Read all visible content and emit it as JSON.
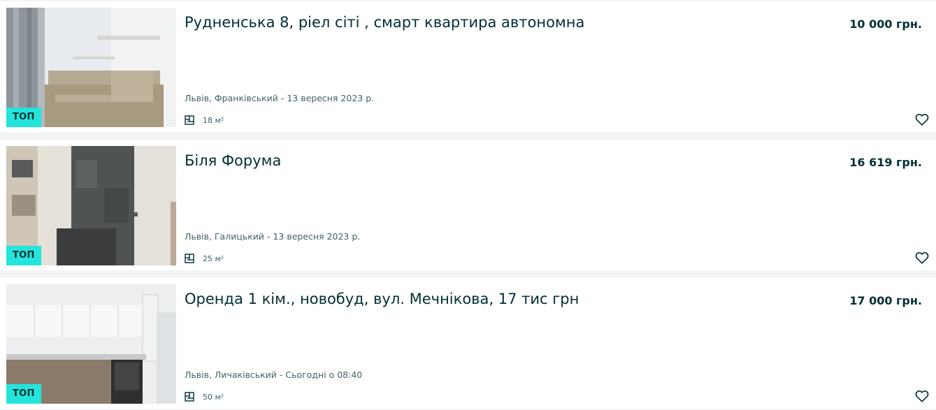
{
  "listings": [
    {
      "title": "Рудненська 8, ріел сіті , смарт квартира автономна",
      "price": "10 000 грн.",
      "location_date": "Львів, Франківський - 13 вересня 2023 р.",
      "area": "18 м²",
      "badge": "ТОП"
    },
    {
      "title": "Біля Форума",
      "price": "16 619 грн.",
      "location_date": "Львів, Галицький - 13 вересня 2023 р.",
      "area": "25 м²",
      "badge": "ТОП"
    },
    {
      "title": "Оренда 1 кім., новобуд, вул. Мечнікова, 17 тис грн",
      "price": "17 000 грн.",
      "location_date": "Львів, Личаківський - Сьогодні о 08:40",
      "area": "50 м²",
      "badge": "ТОП"
    }
  ],
  "icons": {
    "area": "floor-plan-icon",
    "favorite": "heart-outline-icon"
  },
  "colors": {
    "badge": "#23e5db",
    "text": "#002f34",
    "muted": "#406367",
    "page_bg": "#f2f4f5"
  }
}
